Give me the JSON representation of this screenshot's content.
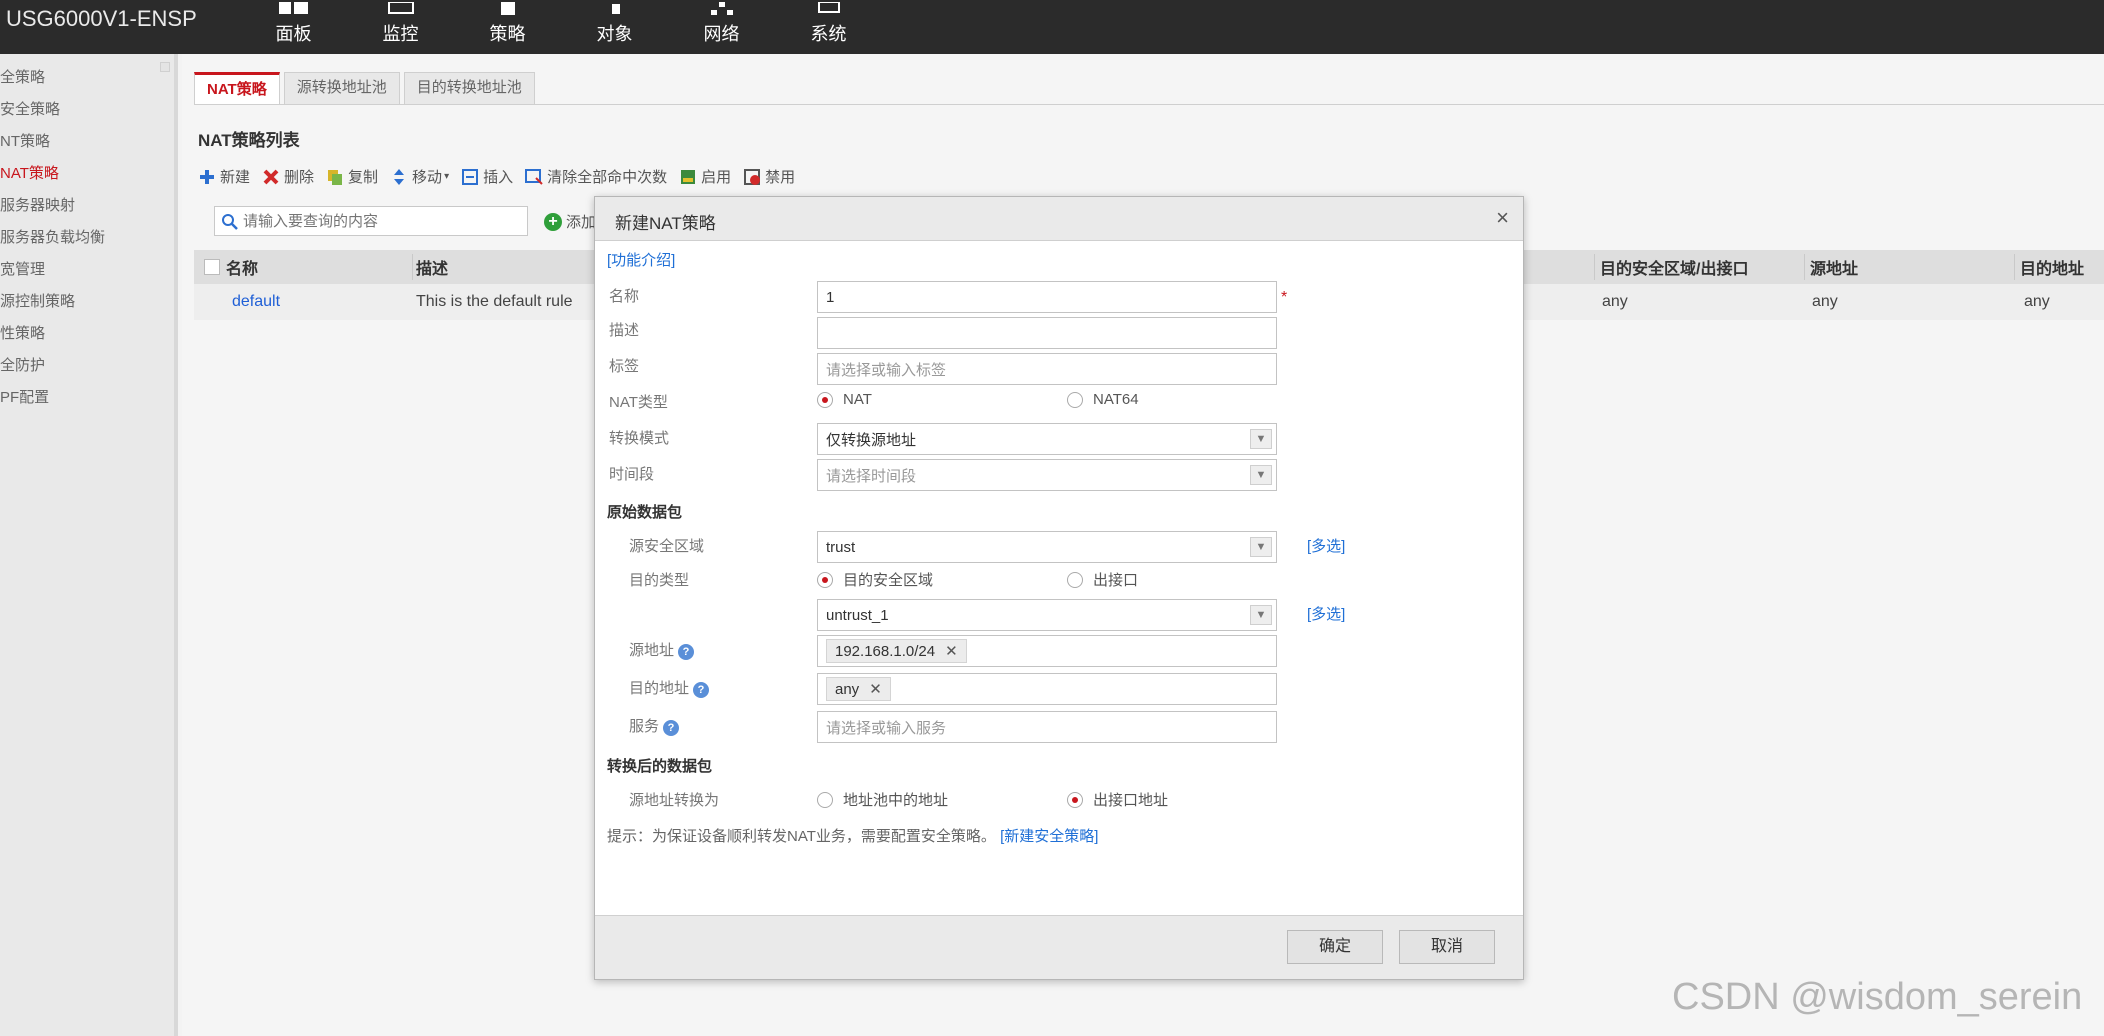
{
  "brand": "USG6000V1-ENSP",
  "topnav": [
    {
      "label": "面板",
      "icon": "dashboard-icon"
    },
    {
      "label": "监控",
      "icon": "monitor-icon"
    },
    {
      "label": "策略",
      "icon": "policy-icon"
    },
    {
      "label": "对象",
      "icon": "object-icon"
    },
    {
      "label": "网络",
      "icon": "network-icon"
    },
    {
      "label": "系统",
      "icon": "system-icon"
    }
  ],
  "sidebar": {
    "items": [
      {
        "label": "全策略"
      },
      {
        "label": "安全策略"
      },
      {
        "label": "NT策略"
      },
      {
        "label": "NAT策略",
        "active": true
      },
      {
        "label": "服务器映射"
      },
      {
        "label": "服务器负载均衡"
      },
      {
        "label": "宽管理"
      },
      {
        "label": "源控制策略"
      },
      {
        "label": "性策略"
      },
      {
        "label": "全防护"
      },
      {
        "label": "PF配置"
      }
    ]
  },
  "tabs": [
    {
      "label": "NAT策略",
      "active": true
    },
    {
      "label": "源转换地址池"
    },
    {
      "label": "目的转换地址池"
    }
  ],
  "panel_title": "NAT策略列表",
  "toolbar": {
    "new": "新建",
    "delete": "删除",
    "copy": "复制",
    "move": "移动",
    "insert": "插入",
    "clear_hits": "清除全部命中次数",
    "enable": "启用",
    "disable": "禁用"
  },
  "search": {
    "placeholder": "请输入要查询的内容",
    "add_filter": "添加"
  },
  "table": {
    "headers": {
      "name": "名称",
      "desc": "描述",
      "dst_zone": "目的安全区域/出接口",
      "src_addr": "源地址",
      "dst_addr": "目的地址"
    },
    "rows": [
      {
        "name": "default",
        "desc": "This is the default rule",
        "dst_zone": "any",
        "src_addr": "any",
        "dst_addr": "any"
      }
    ]
  },
  "modal": {
    "title": "新建NAT策略",
    "close": "×",
    "intro_link": "[功能介绍]",
    "labels": {
      "name": "名称",
      "desc": "描述",
      "tag": "标签",
      "nat_type": "NAT类型",
      "mode": "转换模式",
      "schedule": "时间段",
      "orig_section": "原始数据包",
      "src_zone": "源安全区域",
      "dst_type": "目的类型",
      "src_addr": "源地址",
      "dst_addr": "目的地址",
      "service": "服务",
      "trans_section": "转换后的数据包",
      "src_trans": "源地址转换为"
    },
    "values": {
      "name": "1",
      "desc": "",
      "tag_ph": "请选择或输入标签",
      "nat_opt1": "NAT",
      "nat_opt2": "NAT64",
      "mode": "仅转换源地址",
      "schedule_ph": "请选择时间段",
      "src_zone": "trust",
      "dst_opt1": "目的安全区域",
      "dst_opt2": "出接口",
      "dst_zone": "untrust_1",
      "src_addr_tag": "192.168.1.0/24",
      "dst_addr_tag": "any",
      "service_ph": "请选择或输入服务",
      "trans_opt1": "地址池中的地址",
      "trans_opt2": "出接口地址"
    },
    "more": "[多选]",
    "tip": "提示：为保证设备顺利转发NAT业务，需要配置安全策略。",
    "tip_link": "[新建安全策略]",
    "ok": "确定",
    "cancel": "取消"
  },
  "watermark": "CSDN @wisdom_serein",
  "colors": {
    "accent": "#c8161d",
    "link": "#1f5fd6",
    "topbar": "#2b2b2b"
  }
}
